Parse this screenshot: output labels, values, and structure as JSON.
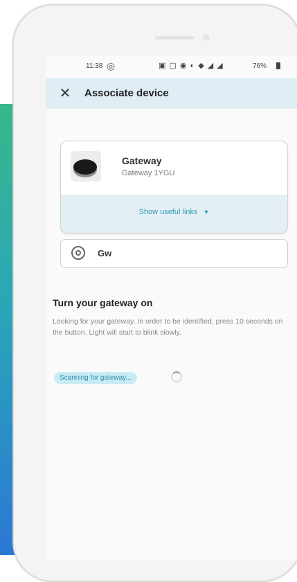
{
  "status_bar": {
    "time": "11:38",
    "icons": "▣ ▢ ◉ ◐ ◆ ◢ ◢",
    "battery": "76%"
  },
  "header": {
    "close_label": "✕",
    "title": "Associate device"
  },
  "device": {
    "name": "Gateway",
    "model": "Gateway 1YGU",
    "links_label": "Show useful links"
  },
  "name_field": {
    "value": "Gw"
  },
  "instructions": {
    "title": "Turn your gateway on",
    "description": "Looking for your gateway. In order to be identified, press 10 seconds on the button. Light will start to blink slowly."
  },
  "scan": {
    "label": "Scanning for gateway..."
  },
  "colors": {
    "header_bg": "#dfeef4",
    "accent": "#2d9bb8",
    "chip_bg": "#c9ebf6"
  }
}
